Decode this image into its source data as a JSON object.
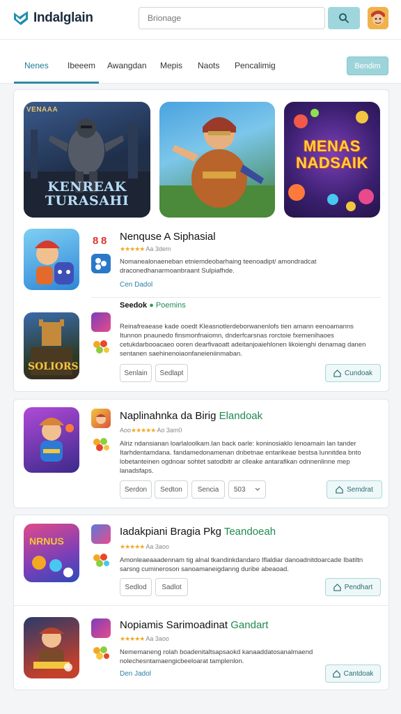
{
  "header": {
    "brand": "Indalglain",
    "search_placeholder": "Brionage"
  },
  "nav": {
    "items": [
      "Nenes",
      "Ibeeem",
      "Awangdan",
      "Mepis",
      "Naots",
      "Pencalimig"
    ],
    "active_index": 0,
    "button_label": "Bendim"
  },
  "banners": [
    {
      "text": "KENREAK TURASAHI",
      "corner": "VENAAA"
    },
    {
      "text": ""
    },
    {
      "text": "MENAS NADSAIK"
    }
  ],
  "card1": {
    "item1": {
      "title": "Nenquse A Siphasial",
      "rating": "Aa 3dem",
      "desc": "Nomanealonaeneban etniemdeobarhaing teenoadipt/ amondradcat draconedhanarmoanbraant Sulpiafhde.",
      "link": "Cen Dadol"
    },
    "item2": {
      "title": "Seedok",
      "title_hl": "Poemins",
      "desc": "Reinafreaease kade ooedt Kleasnotlerdeborwanenlofs tien amann eenoamanns Itunnon pnaunedo finsmonfnaiomn, dnderfcarsnas rorctoie fxemenihaoes cetukdarbooacaeo ooren dearfivaoatt adeitanjoaiehlonen likoienghi denamag danen sentanen saehinenoiaonfaneieniinmaban.",
      "tags": [
        "Senlain",
        "Sedlapt"
      ],
      "download": "Cundoak"
    }
  },
  "card2": {
    "title": "Naplinahnka da Birig",
    "title_hl": "Elandoak",
    "rating": "Ao 3am0",
    "desc": "Alriz ndansianan loarlaloolkam.lan back oarle: koninosiaklo lenoamain lan tander Itarhdentamdana. fandamedonamenan dnbetnae entarikeae bestsa lunnitdea bnto lobetanteinen ogdnoar sohtet satodbitr ar clleake antarafikan odnnenlinne mep lanadsfaps.",
    "tags": [
      "Serdon",
      "Sedton",
      "Sencia",
      "503"
    ],
    "download": "Semdrat"
  },
  "card3": {
    "item1": {
      "title": "Iadakpiani Bragia Pkg",
      "title_hl": "Teandoeah",
      "rating": "Aa 3aoo",
      "desc": "Amonleaeaaadennam tig alnal tkandinkdandaro Iflaldiar danoadnitdoarcade Ibatiltn sarsng cumineroson sanoamaneigdanng duribe abeaoad.",
      "tags": [
        "Sedlod",
        "Sadlot"
      ],
      "download": "Pendhart"
    },
    "item2": {
      "title": "Nopiamis Sarimoadinat",
      "title_hl": "Gandart",
      "rating": "Aa 3aoo",
      "desc": "Nememaneng rolah boadenitaltsapsaokd kanaaddatosanalmaend nolechesntamaengicbeeloarat tamplenlon.",
      "link": "Den Jadol",
      "download": "Cantdoak"
    }
  },
  "colors": {
    "accent": "#2f8aa3",
    "highlight_green": "#1e8a4f",
    "star": "#f3a823"
  }
}
